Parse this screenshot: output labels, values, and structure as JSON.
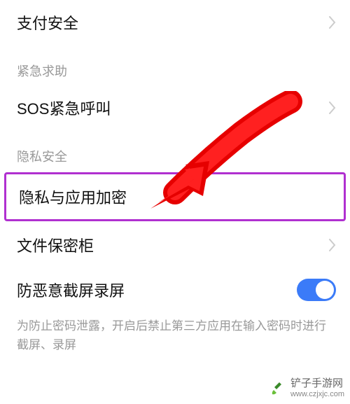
{
  "rows": {
    "payment_security": "支付安全"
  },
  "sections": {
    "emergency": {
      "header": "紧急求助",
      "sos": "SOS紧急呼叫"
    },
    "privacy": {
      "header": "隐私安全",
      "privacy_encrypt": "隐私与应用加密",
      "file_safe": "文件保密柜",
      "anti_screenshot": "防恶意截屏录屏",
      "anti_screenshot_desc": "为防止密码泄露，开启后禁止第三方应用在输入密码时进行截屏、录屏"
    }
  },
  "watermark": {
    "name": "铲子手游网",
    "url": "www.czjxjc.com"
  }
}
